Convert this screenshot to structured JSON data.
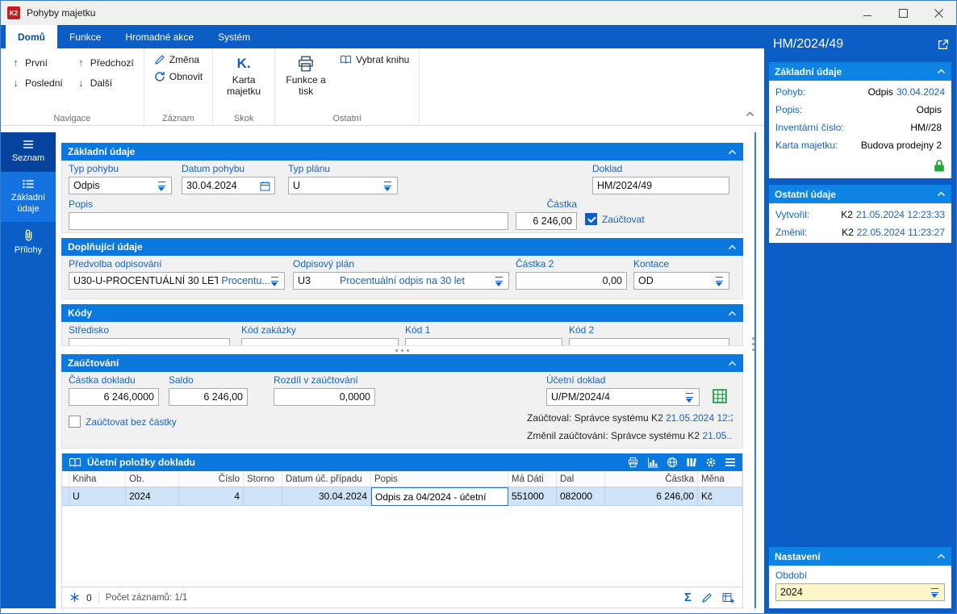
{
  "window": {
    "title": "Pohyby majetku"
  },
  "colors": {
    "accent_blue": "#0b5ec6",
    "header_blue": "#0a78dc",
    "label_blue": "#1464c8",
    "lock_green": "#1fa83c",
    "selected_row": "#cfe4f8"
  },
  "icons": {
    "arrow_up": "↑",
    "arrow_down": "↓",
    "sum": "Σ",
    "k_jump": "K."
  },
  "ribbon": {
    "tabs": [
      "Domů",
      "Funkce",
      "Hromadné akce",
      "Systém"
    ],
    "groups": {
      "navigace": {
        "label": "Navigace",
        "first": "První",
        "prev": "Předchozí",
        "last": "Poslední",
        "next": "Další"
      },
      "zaznam": {
        "label": "Záznam",
        "change": "Změna",
        "refresh": "Obnovit"
      },
      "skok": {
        "label": "Skok",
        "asset_card": "Karta majetku"
      },
      "ostatni": {
        "label": "Ostatní",
        "print": "Funkce a tisk",
        "select_book": "Vybrat knihu"
      }
    }
  },
  "sidebar": {
    "items": [
      {
        "label": "Seznam"
      },
      {
        "label": "Základní údaje"
      },
      {
        "label": "Přílohy"
      }
    ]
  },
  "form": {
    "basic": {
      "title": "Základní údaje",
      "typ_pohybu": {
        "label": "Typ pohybu",
        "value": "Odpis"
      },
      "datum_pohybu": {
        "label": "Datum pohybu",
        "value": "30.04.2024"
      },
      "typ_planu": {
        "label": "Typ plánu",
        "value": "U"
      },
      "doklad": {
        "label": "Doklad",
        "value": "HM/2024/49"
      },
      "popis": {
        "label": "Popis",
        "value": ""
      },
      "castka": {
        "label": "Částka",
        "value": "6 246,00"
      },
      "zauctovat": {
        "label": "Zaúčtovat",
        "checked": true
      }
    },
    "additional": {
      "title": "Doplňující údaje",
      "predvolba": {
        "label": "Předvolba odpisování",
        "value": "U30-U-PROCENTUÁLNÍ 30 LET",
        "value2": "Procentu..."
      },
      "odpisovy_plan": {
        "label": "Odpisový plán",
        "value": "U3",
        "value2": "Procentuální odpis na 30 let"
      },
      "castka2": {
        "label": "Částka 2",
        "value": "0,00"
      },
      "kontace": {
        "label": "Kontace",
        "value": "OD"
      }
    },
    "kody": {
      "title": "Kódy",
      "stredisko_label": "Středisko",
      "kod_zakazky_label": "Kód zakázky",
      "kod1_label": "Kód 1",
      "kod2_label": "Kód 2"
    },
    "zauctovani": {
      "title": "Zaúčtování",
      "castka_dokladu": {
        "label": "Částka dokladu",
        "value": "6 246,0000"
      },
      "saldo": {
        "label": "Saldo",
        "value": "6 246,00"
      },
      "rozdil": {
        "label": "Rozdíl v zaúčtování",
        "value": "0,0000"
      },
      "ucetni_doklad": {
        "label": "Účetní doklad",
        "value": "U/PM/2024/4"
      },
      "bez_castky": {
        "label": "Zaúčtovat bez částky",
        "checked": false
      },
      "zauctoval_text": "Zaúčtoval: Správce systému K2",
      "zauctoval_date": "21.05.2024 12:2...",
      "zmenil_text": "Změnil zaúčtování: Správce systému K2",
      "zmenil_date": "21.05..."
    }
  },
  "table": {
    "title": "Účetní položky dokladu",
    "columns": [
      "Kniha",
      "Ob.",
      "Číslo",
      "Storno",
      "Datum úč. případu",
      "Popis",
      "Má Dáti",
      "Dal",
      "Částka",
      "Měna"
    ],
    "rows": [
      [
        "U",
        "2024",
        "4",
        "",
        "30.04.2024",
        "Odpis za 04/2024 - účetní",
        "551000",
        "082000",
        "6 246,00",
        "Kč"
      ]
    ],
    "footer": {
      "badge": "0",
      "records": "Počet záznamů: 1/1"
    }
  },
  "panel": {
    "title": "HM/2024/49",
    "basic": {
      "title": "Základní údaje",
      "rows": [
        {
          "label": "Pohyb:",
          "value": "Odpis",
          "extra": "30.04.2024"
        },
        {
          "label": "Popis:",
          "value": "Odpis",
          "extra": ""
        },
        {
          "label": "Inventární číslo:",
          "value": "HM//28",
          "extra": ""
        },
        {
          "label": "Karta majetku:",
          "value": "Budova prodejny 2",
          "extra": ""
        }
      ]
    },
    "other": {
      "title": "Ostatní údaje",
      "rows": [
        {
          "label": "Vytvořil:",
          "value": "K2",
          "extra": "21.05.2024 12:23:33"
        },
        {
          "label": "Změnil:",
          "value": "K2",
          "extra": "22.05.2024 11:23:27"
        }
      ]
    },
    "settings": {
      "title": "Nastavení",
      "period_label": "Období",
      "period_value": "2024"
    }
  }
}
